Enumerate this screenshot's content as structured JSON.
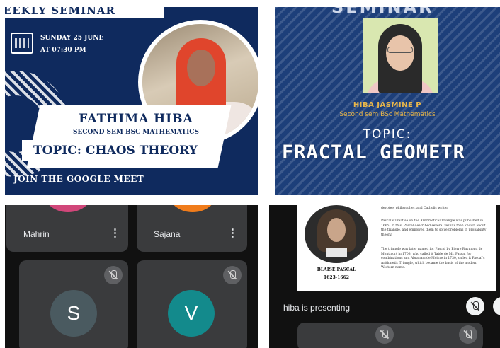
{
  "poster_left": {
    "top_banner": "WEEKLY SEMINAR",
    "date_line1": "SUNDAY 25 JUNE",
    "date_line2": "AT 07:30 PM",
    "speaker_name": "FATHIMA HIBA",
    "speaker_role": "SECOND SEM BSC MATHEMATICS",
    "topic": "TOPIC: CHAOS THEORY",
    "cta": "JOIN THE GOOGLE MEET",
    "colors": {
      "background": "#0f2a5e",
      "accent": "#ffffff"
    }
  },
  "poster_right": {
    "heading": "SEMINAR",
    "speaker_name": "HIBA JASMINE P",
    "speaker_role": "Second sem BSc Mathematics",
    "topic_label": "TOPIC:",
    "topic_value": "FRACTAL GEOMETR",
    "colors": {
      "background": "#1d3f7a",
      "name": "#e8b64a"
    }
  },
  "meet_tiles": {
    "participants": [
      {
        "name": "Mahrin",
        "avatar_color": "#d1477a"
      },
      {
        "name": "Sajana",
        "avatar_color": "#f07c1b"
      },
      {
        "letter": "S",
        "avatar_color": "#4a5a60",
        "muted": true
      },
      {
        "letter": "V",
        "avatar_color": "#138a8c",
        "muted": true
      }
    ],
    "more_icon": "more-vert-icon",
    "mic_icon": "mic-off-icon"
  },
  "presentation": {
    "slide_text_top": "devotee, philosopher, and Catholic writer.",
    "slide_para1": "Pascal's Treatise on the Arithmetical Triangle was published in 1665. In this, Pascal described several results then known about the triangle, and employed them to solve problems in probability theory.",
    "slide_para2": "The triangle was later named for Pascal by Pierre Raymond de Montmort in 1708, who called it Table de Mr. Pascal for combinations and Abraham de Moivre in 1730, called it Pascal's Arithmetic Triangle, which became the basis of the modern Western name.",
    "caption_name": "BLAISE PASCAL",
    "caption_years": "1623-1662",
    "presenting_label": "hiba is presenting"
  }
}
